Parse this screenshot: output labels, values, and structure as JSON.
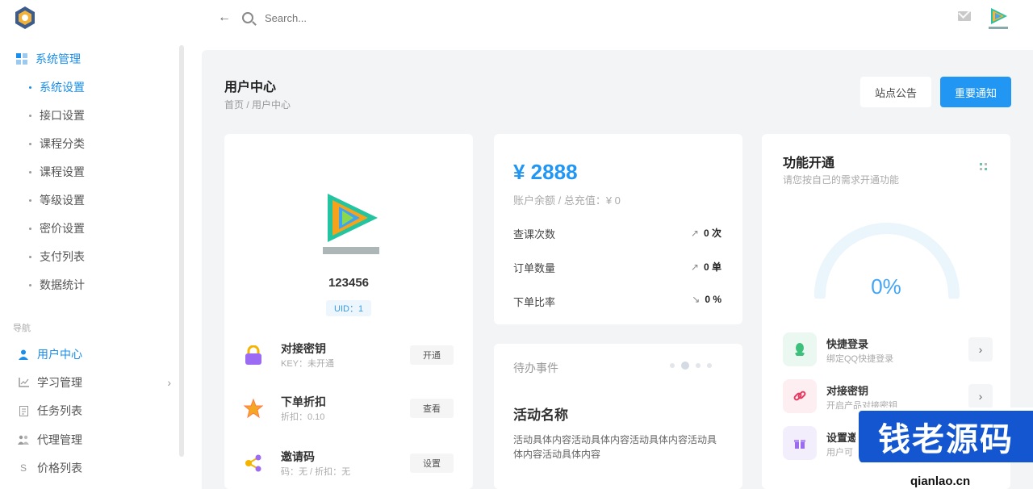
{
  "topbar": {
    "search_placeholder": "Search..."
  },
  "sidebar": {
    "group": {
      "label": "系统管理"
    },
    "sub_items": [
      {
        "label": "系统设置",
        "active": true
      },
      {
        "label": "接口设置"
      },
      {
        "label": "课程分类"
      },
      {
        "label": "课程设置"
      },
      {
        "label": "等级设置"
      },
      {
        "label": "密价设置"
      },
      {
        "label": "支付列表"
      },
      {
        "label": "数据统计"
      }
    ],
    "nav_title": "导航",
    "nav_items": [
      {
        "label": "用户中心",
        "icon": "user-icon",
        "active": true
      },
      {
        "label": "学习管理",
        "icon": "chart-icon",
        "has_children": true
      },
      {
        "label": "任务列表",
        "icon": "doc-icon"
      },
      {
        "label": "代理管理",
        "icon": "group-icon"
      },
      {
        "label": "价格列表",
        "icon": "dollar-icon"
      }
    ]
  },
  "header": {
    "title": "用户中心",
    "breadcrumb": "首页 / 用户中心",
    "btn_notice": "站点公告",
    "btn_important": "重要通知"
  },
  "profile": {
    "username": "123456",
    "uid": "UID：1",
    "features": [
      {
        "title": "对接密钥",
        "sub": "KEY：未开通",
        "button": "开通",
        "icon": "lock-icon"
      },
      {
        "title": "下单折扣",
        "sub": "折扣：0.10",
        "button": "查看",
        "icon": "star-icon"
      },
      {
        "title": "邀请码",
        "sub": "码：无 / 折扣：无",
        "button": "设置",
        "icon": "share-icon"
      }
    ]
  },
  "balance": {
    "amount": "¥ 2888",
    "sub": "账户余额 / 总充值：¥ 0",
    "stats": [
      {
        "label": "查课次数",
        "value": "0 次",
        "icon": "↗"
      },
      {
        "label": "订单数量",
        "value": "0 单",
        "icon": "↗"
      },
      {
        "label": "下单比率",
        "value": "0 %",
        "icon": "↘"
      }
    ]
  },
  "todo": {
    "title": "待办事件",
    "activity_name": "活动名称",
    "activity_body": "活动具体内容活动具体内容活动具体内容活动具体内容活动具体内容"
  },
  "functions": {
    "title": "功能开通",
    "sub": "请您按自己的需求开通功能",
    "gauge_value": "0%",
    "gauge_fraction": 0,
    "items": [
      {
        "title": "快捷登录",
        "sub": "绑定QQ快捷登录",
        "icon": "qq-icon"
      },
      {
        "title": "对接密钥",
        "sub": "开启产品对接密钥",
        "icon": "link-icon"
      },
      {
        "title": "设置邀",
        "sub": "用户可",
        "icon": "gift-icon"
      }
    ]
  },
  "watermark": {
    "text": "钱老源码",
    "url": "qianlao.cn"
  },
  "colors": {
    "accent": "#2196f3",
    "background": "#f3f4f6"
  }
}
